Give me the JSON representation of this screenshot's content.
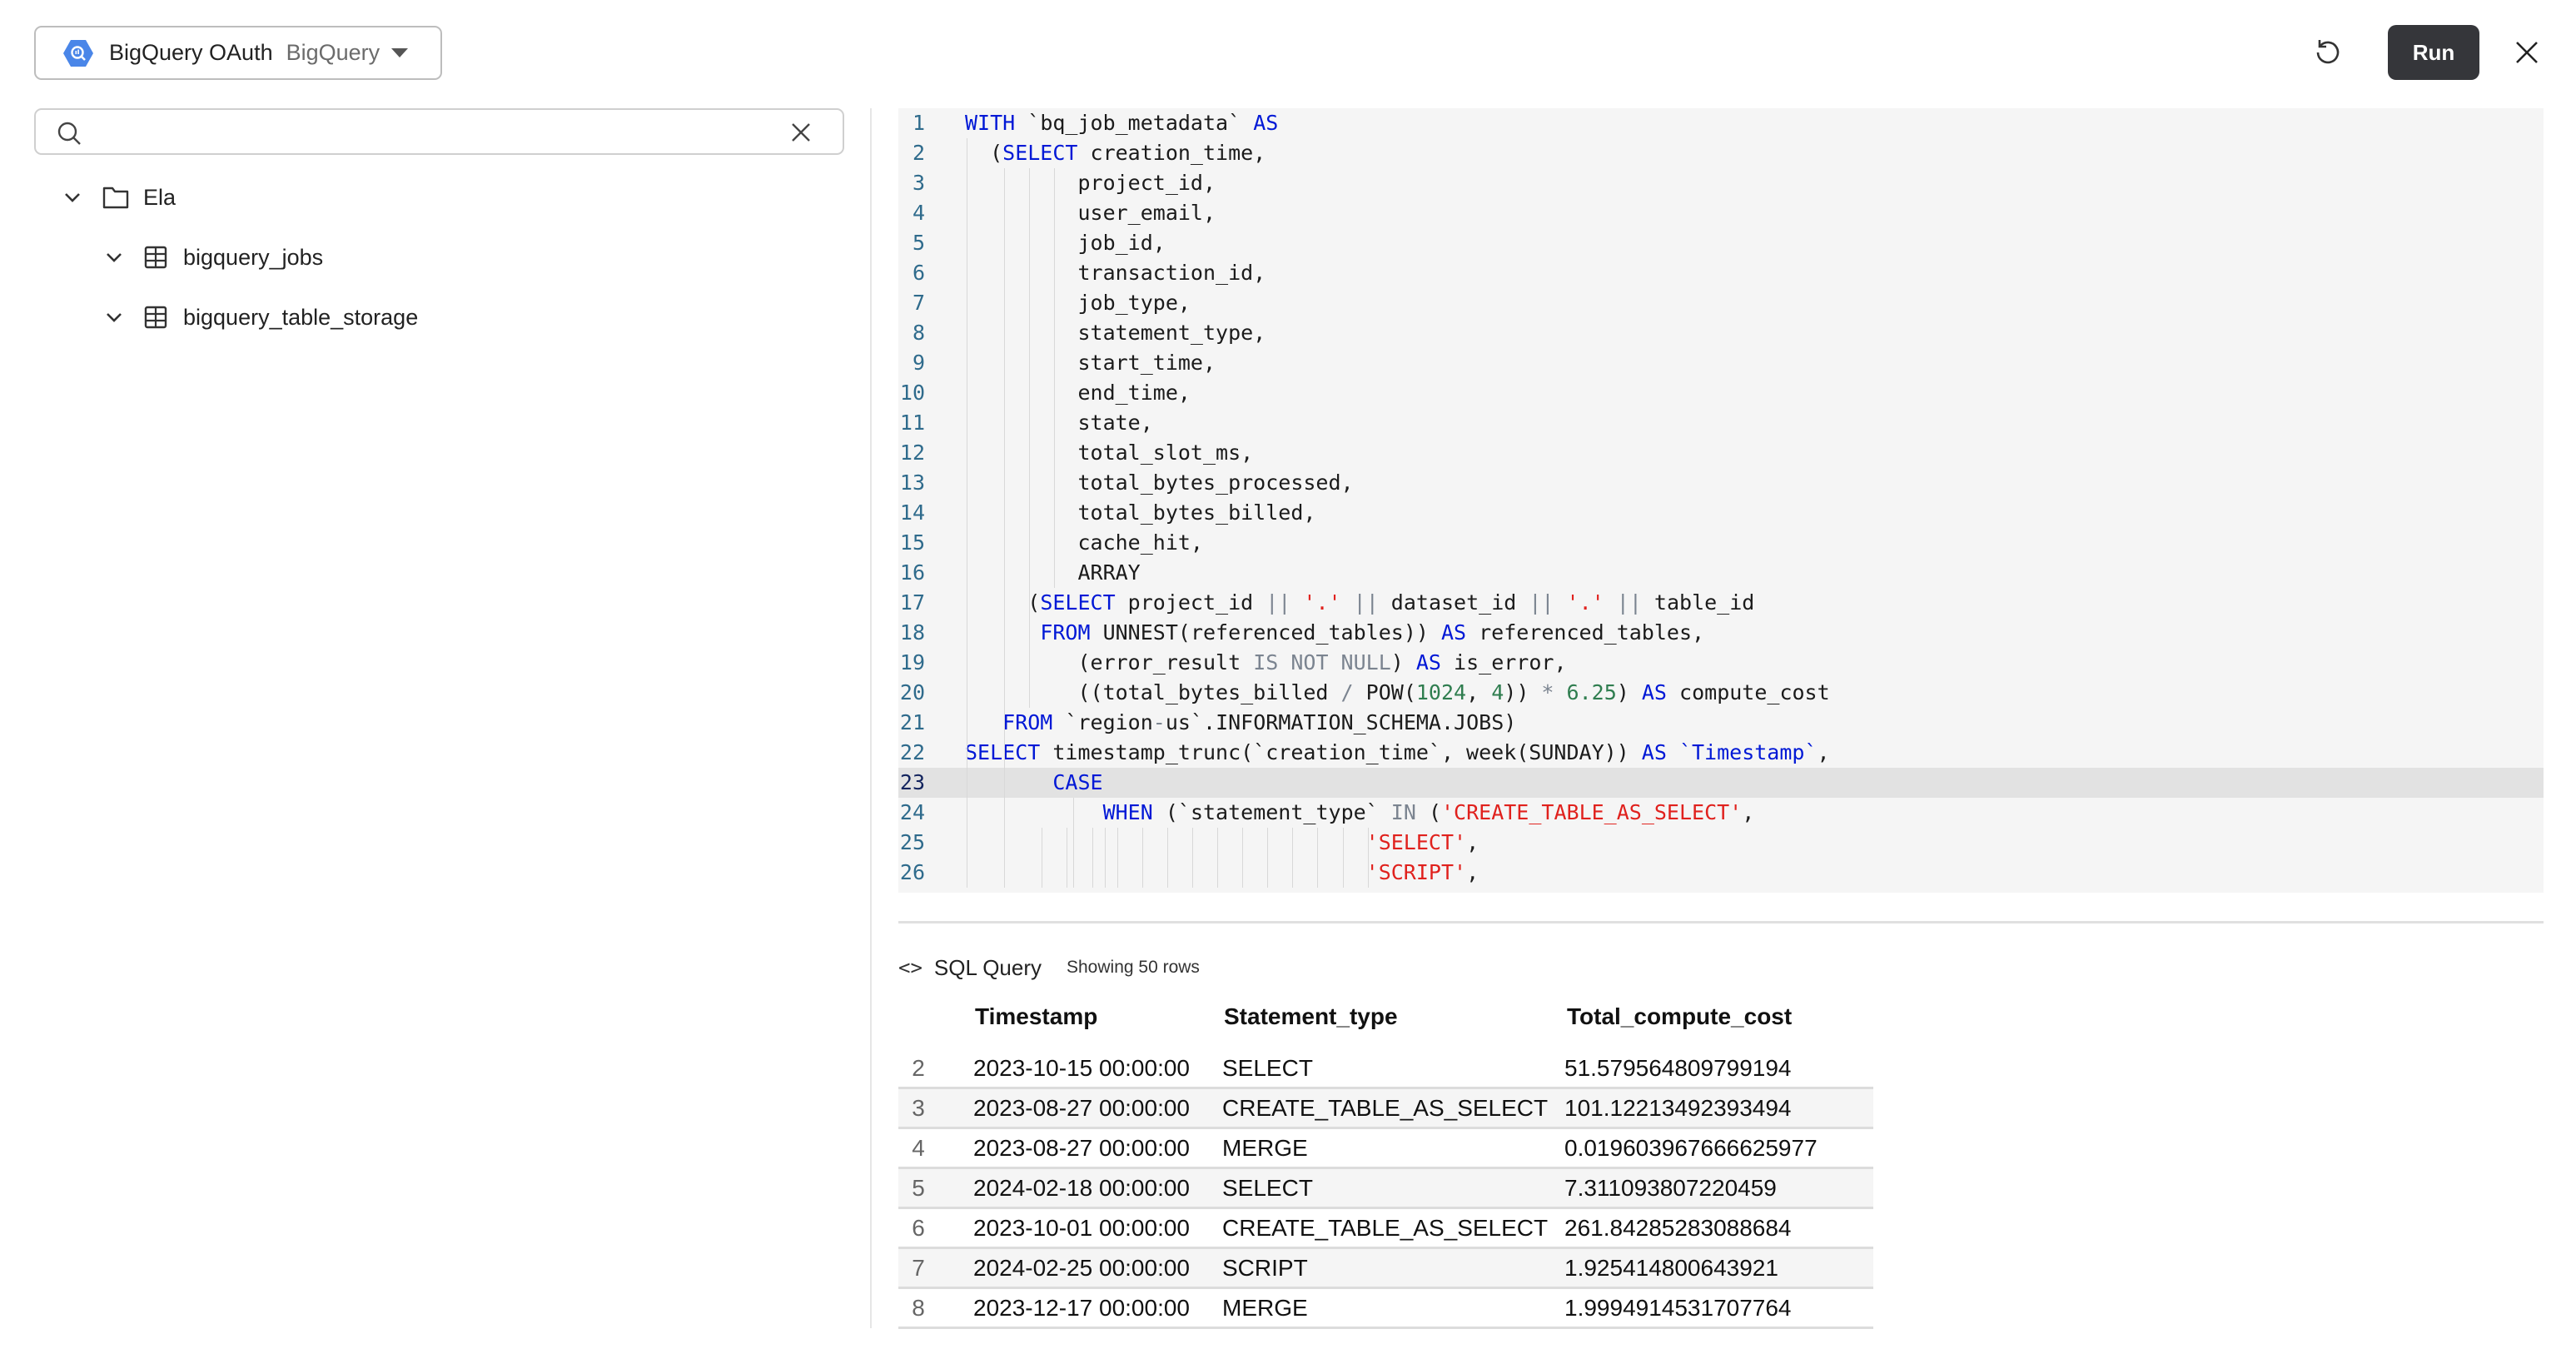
{
  "connection": {
    "name": "BigQuery OAuth",
    "type": "BigQuery",
    "icon": "bigquery-hexagon-icon",
    "brand_color": "#4a86e8"
  },
  "search": {
    "value": "",
    "placeholder": ""
  },
  "tree": [
    {
      "label": "Ela",
      "icon": "folder-icon",
      "expanded": true
    },
    {
      "label": "bigquery_jobs",
      "icon": "table-icon",
      "expanded": true
    },
    {
      "label": "bigquery_table_storage",
      "icon": "table-icon",
      "expanded": true
    }
  ],
  "toolbar": {
    "run_label": "Run",
    "refresh_icon": "refresh-icon",
    "close_icon": "close-icon"
  },
  "editor": {
    "active_line": 23,
    "lines": [
      [
        [
          "kw",
          "WITH"
        ],
        [
          "t",
          " `bq_job_metadata` "
        ],
        [
          "kw",
          "AS"
        ]
      ],
      [
        [
          "t",
          "  ("
        ],
        [
          "kw",
          "SELECT"
        ],
        [
          "t",
          " creation_time,"
        ]
      ],
      [
        [
          "t",
          "         project_id,"
        ]
      ],
      [
        [
          "t",
          "         user_email,"
        ]
      ],
      [
        [
          "t",
          "         job_id,"
        ]
      ],
      [
        [
          "t",
          "         transaction_id,"
        ]
      ],
      [
        [
          "t",
          "         job_type,"
        ]
      ],
      [
        [
          "t",
          "         statement_type,"
        ]
      ],
      [
        [
          "t",
          "         start_time,"
        ]
      ],
      [
        [
          "t",
          "         end_time,"
        ]
      ],
      [
        [
          "t",
          "         state,"
        ]
      ],
      [
        [
          "t",
          "         total_slot_ms,"
        ]
      ],
      [
        [
          "t",
          "         total_bytes_processed,"
        ]
      ],
      [
        [
          "t",
          "         total_bytes_billed,"
        ]
      ],
      [
        [
          "t",
          "         cache_hit,"
        ]
      ],
      [
        [
          "t",
          "         ARRAY"
        ]
      ],
      [
        [
          "t",
          "     ("
        ],
        [
          "kw",
          "SELECT"
        ],
        [
          "t",
          " project_id "
        ],
        [
          "op",
          "||"
        ],
        [
          "t",
          " "
        ],
        [
          "str",
          "'.'"
        ],
        [
          "t",
          " "
        ],
        [
          "op",
          "||"
        ],
        [
          "t",
          " dataset_id "
        ],
        [
          "op",
          "||"
        ],
        [
          "t",
          " "
        ],
        [
          "str",
          "'.'"
        ],
        [
          "t",
          " "
        ],
        [
          "op",
          "||"
        ],
        [
          "t",
          " table_id"
        ]
      ],
      [
        [
          "t",
          "      "
        ],
        [
          "kw",
          "FROM"
        ],
        [
          "t",
          " UNNEST(referenced_tables)) "
        ],
        [
          "kw",
          "AS"
        ],
        [
          "t",
          " referenced_tables,"
        ]
      ],
      [
        [
          "t",
          "         (error_result "
        ],
        [
          "op",
          "IS NOT NULL"
        ],
        [
          "t",
          ") "
        ],
        [
          "kw",
          "AS"
        ],
        [
          "t",
          " is_error,"
        ]
      ],
      [
        [
          "t",
          "         ((total_bytes_billed "
        ],
        [
          "op",
          "/"
        ],
        [
          "t",
          " POW("
        ],
        [
          "num",
          "1024"
        ],
        [
          "t",
          ", "
        ],
        [
          "num",
          "4"
        ],
        [
          "t",
          ")) "
        ],
        [
          "op",
          "*"
        ],
        [
          "t",
          " "
        ],
        [
          "num",
          "6.25"
        ],
        [
          "t",
          ") "
        ],
        [
          "kw",
          "AS"
        ],
        [
          "t",
          " compute_cost"
        ]
      ],
      [
        [
          "t",
          "   "
        ],
        [
          "kw",
          "FROM"
        ],
        [
          "t",
          " `region"
        ],
        [
          "op",
          "-"
        ],
        [
          "t",
          "us`.INFORMATION_SCHEMA.JOBS)"
        ]
      ],
      [
        [
          "kw",
          "SELECT"
        ],
        [
          "t",
          " timestamp_trunc(`creation_time`, week(SUNDAY)) "
        ],
        [
          "kw",
          "AS"
        ],
        [
          "t",
          " "
        ],
        [
          "kw",
          "`Timestamp`"
        ],
        [
          "t",
          ","
        ]
      ],
      [
        [
          "t",
          "       "
        ],
        [
          "kw",
          "CASE"
        ]
      ],
      [
        [
          "t",
          "           "
        ],
        [
          "kw",
          "WHEN"
        ],
        [
          "t",
          " (`statement_type` "
        ],
        [
          "op",
          "IN"
        ],
        [
          "t",
          " ("
        ],
        [
          "str",
          "'CREATE_TABLE_AS_SELECT'"
        ],
        [
          "t",
          ","
        ]
      ],
      [
        [
          "t",
          "                                "
        ],
        [
          "str",
          "'SELECT'"
        ],
        [
          "t",
          ","
        ]
      ],
      [
        [
          "t",
          "                                "
        ],
        [
          "str",
          "'SCRIPT'"
        ],
        [
          "t",
          ","
        ]
      ]
    ]
  },
  "results": {
    "title": "SQL Query",
    "row_count_text": "Showing 50 rows",
    "columns": [
      "Timestamp",
      "Statement_type",
      "Total_compute_cost"
    ],
    "rows": [
      {
        "idx": "2",
        "cells": [
          "2023-10-15 00:00:00",
          "SELECT",
          "51.579564809799194"
        ]
      },
      {
        "idx": "3",
        "cells": [
          "2023-08-27 00:00:00",
          "CREATE_TABLE_AS_SELECT",
          "101.12213492393494"
        ]
      },
      {
        "idx": "4",
        "cells": [
          "2023-08-27 00:00:00",
          "MERGE",
          "0.019603967666625977"
        ]
      },
      {
        "idx": "5",
        "cells": [
          "2024-02-18 00:00:00",
          "SELECT",
          "7.311093807220459"
        ]
      },
      {
        "idx": "6",
        "cells": [
          "2023-10-01 00:00:00",
          "CREATE_TABLE_AS_SELECT",
          "261.84285283088684"
        ]
      },
      {
        "idx": "7",
        "cells": [
          "2024-02-25 00:00:00",
          "SCRIPT",
          "1.925414800643921"
        ]
      },
      {
        "idx": "8",
        "cells": [
          "2023-12-17 00:00:00",
          "MERGE",
          "1.9994914531707764"
        ]
      }
    ]
  }
}
